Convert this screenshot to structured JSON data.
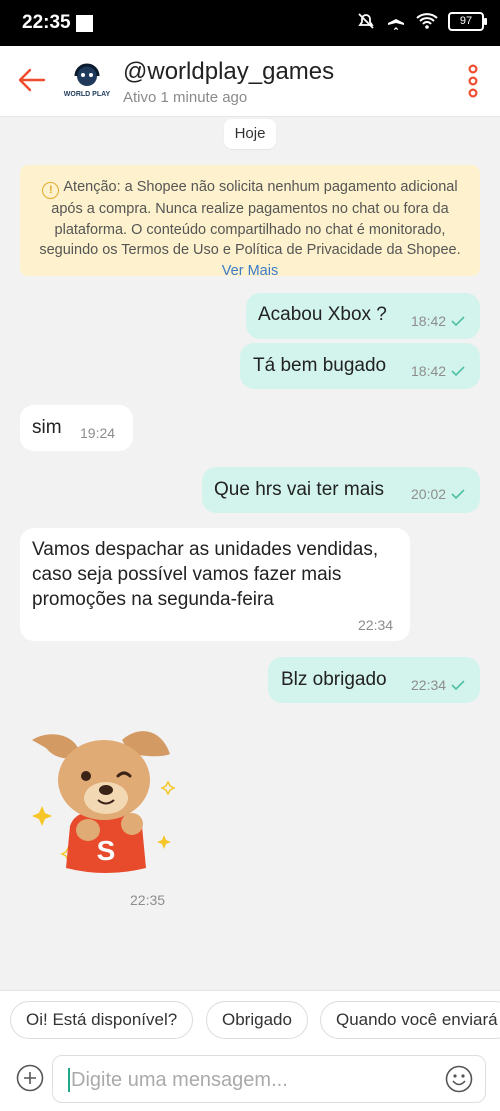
{
  "status_bar": {
    "time": "22:35",
    "battery": "97"
  },
  "header": {
    "username": "@worldplay_games",
    "status": "Ativo 1 minute ago",
    "logo_text": "WORLD PLAY"
  },
  "date_chip": "Hoje",
  "notice": {
    "text": "Atenção: a Shopee não solicita nenhum pagamento adicional após a compra. Nunca realize pagamentos no chat ou fora da plataforma. O conteúdo compartilhado no chat é monitorado, seguindo os Termos de Uso e Política de Privacidade da Shopee.",
    "link": "Ver Mais"
  },
  "messages": [
    {
      "direction": "out",
      "text": "Acabou Xbox ?",
      "time": "18:42"
    },
    {
      "direction": "out",
      "text": "Tá bem bugado",
      "time": "18:42"
    },
    {
      "direction": "in",
      "text": "sim",
      "time": "19:24"
    },
    {
      "direction": "out",
      "text": "Que hrs vai ter mais",
      "time": "20:02"
    },
    {
      "direction": "in",
      "text": "Vamos despachar as unidades vendidas, caso seja possível vamos fazer mais promoções na segunda-feira",
      "time": "22:34"
    },
    {
      "direction": "out",
      "text": "Blz obrigado",
      "time": "22:34"
    }
  ],
  "sticker": {
    "time": "22:35",
    "badge": "S"
  },
  "quick_replies": [
    "Oi! Está disponível?",
    "Obrigado",
    "Quando você enviará"
  ],
  "input": {
    "placeholder": "Digite uma mensagem..."
  },
  "colors": {
    "accent": "#ee4d2d",
    "out_bubble": "#d3f4ec",
    "link": "#3d7ac9",
    "notice_bg": "#fdf2cd"
  }
}
